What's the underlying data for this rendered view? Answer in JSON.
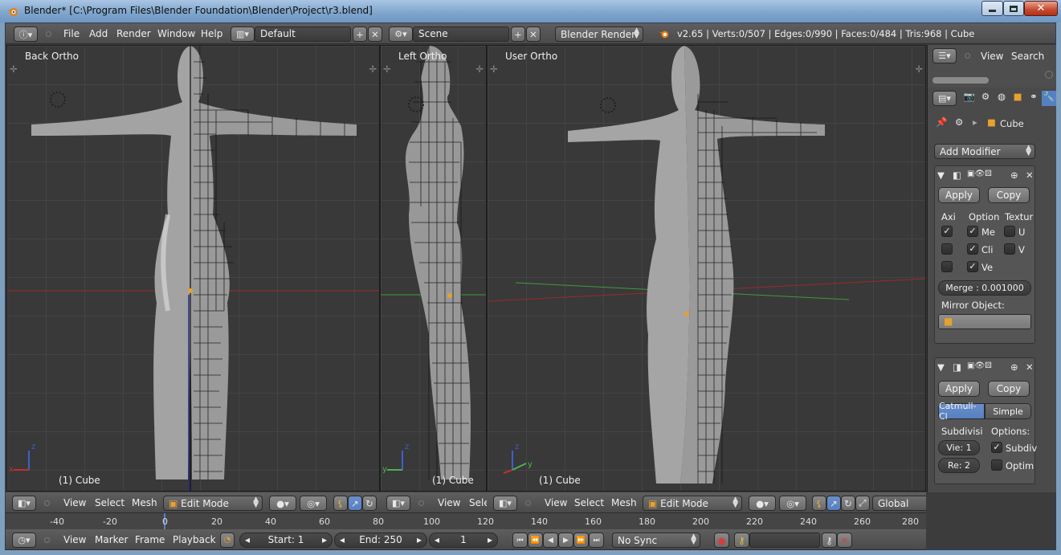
{
  "window": {
    "title": "Blender* [C:\\Program Files\\Blender Foundation\\Blender\\Project\\r3.blend]"
  },
  "info_header": {
    "menus": [
      "File",
      "Add",
      "Render",
      "Window",
      "Help"
    ],
    "layout": "Default",
    "scene": "Scene",
    "engine": "Blender Render",
    "stats": "v2.65 | Verts:0/507 | Edges:0/990 | Faces:0/484 | Tris:968 | Cube"
  },
  "viewports": [
    {
      "label": "Back Ortho",
      "object": "(1) Cube"
    },
    {
      "label": "Left Ortho",
      "object": "(1) Cube"
    },
    {
      "label": "User Ortho",
      "object": "(1) Cube"
    }
  ],
  "view_header": {
    "menus": [
      "View",
      "Select",
      "Mesh"
    ],
    "mode": "Edit Mode",
    "orientation": "Global"
  },
  "view_header_mid": {
    "menus": [
      "View",
      "Sele"
    ]
  },
  "outliner": {
    "menus": [
      "View",
      "Search"
    ]
  },
  "properties": {
    "object_name": "Cube",
    "add_modifier": "Add Modifier",
    "mirror": {
      "apply": "Apply",
      "copy": "Copy",
      "col_axis": "Axi",
      "col_option": "Option",
      "col_texture": "Textur",
      "opt1": "Me",
      "opt2": "Cli",
      "opt3": "Ve",
      "tex_u": "U",
      "tex_v": "V",
      "merge": "Merge : 0.001000",
      "mirror_object_label": "Mirror Object:"
    },
    "subsurf": {
      "apply": "Apply",
      "copy": "Copy",
      "catmull": "Catmull-Cl",
      "simple": "Simple",
      "subdiv_label": "Subdivisi",
      "options_label": "Options:",
      "view": "Vie: 1",
      "render": "Re: 2",
      "opt_subdiv": "Subdiv",
      "opt_optimal": "Optim"
    }
  },
  "timeline": {
    "ticks": [
      "-40",
      "-20",
      "0",
      "20",
      "40",
      "60",
      "80",
      "100",
      "120",
      "140",
      "160",
      "180",
      "200",
      "220",
      "240",
      "260",
      "280"
    ],
    "menus": [
      "View",
      "Marker",
      "Frame",
      "Playback"
    ],
    "start": "Start: 1",
    "end": "End: 250",
    "current": "1",
    "sync": "No Sync"
  },
  "colors": {
    "accent": "#5680c2",
    "x_axis": "#c03030",
    "y_axis": "#4fb04f",
    "z_axis": "#3c5fd0",
    "vertex": "#e8a030"
  }
}
